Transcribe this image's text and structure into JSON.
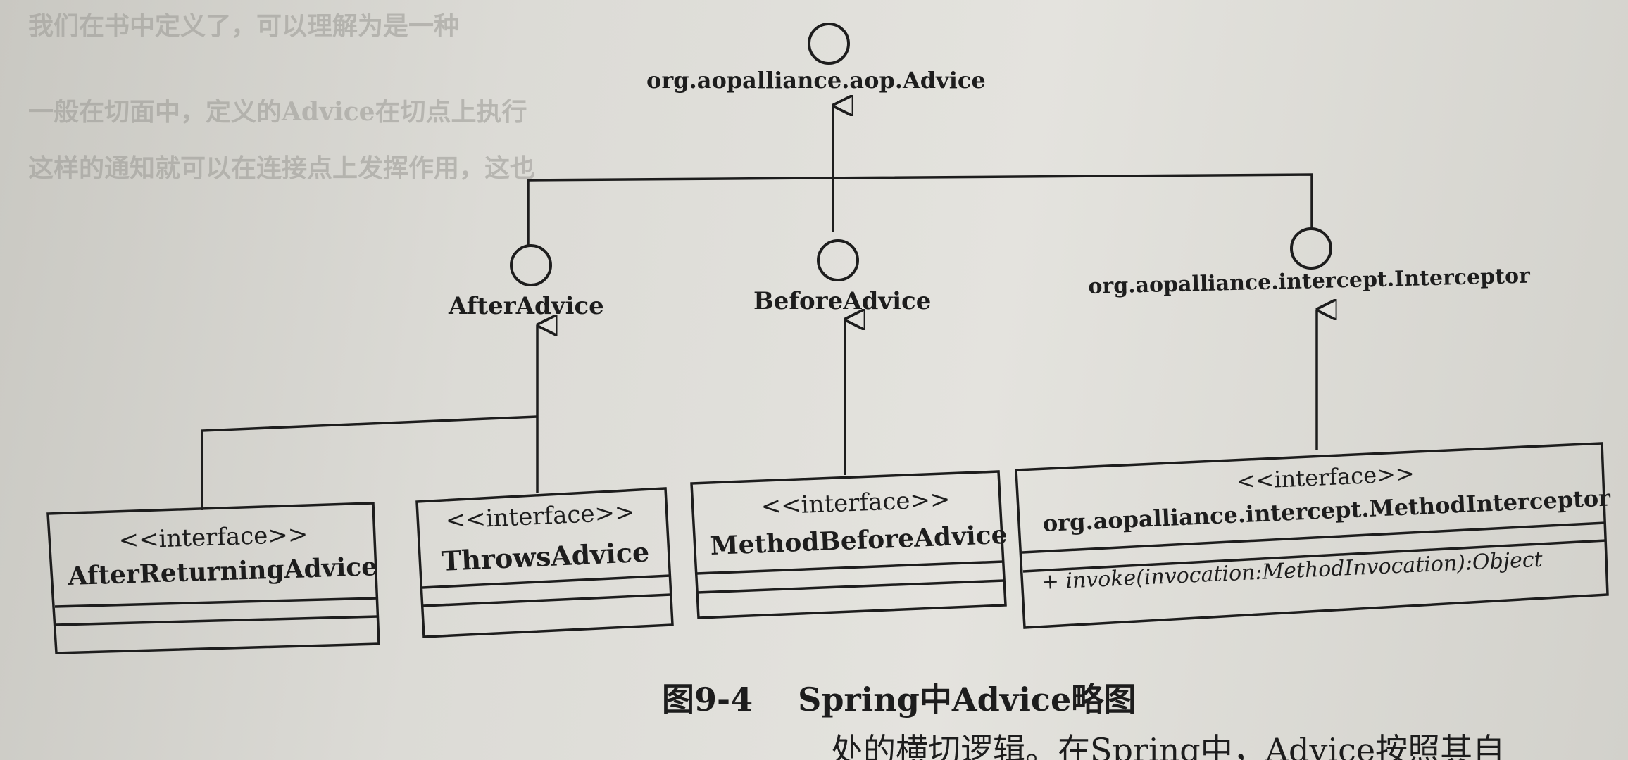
{
  "background_text": [
    "我们在书中定义了，可以理解为是一种",
    "一般在切面中，定义的Advice在切点上执行",
    "这样的通知就可以在连接点上发挥作用，这也"
  ],
  "nodes": {
    "advice": {
      "name": "org.aopalliance.aop.Advice",
      "symbol": "interface-lollipop"
    },
    "after_advice": {
      "name": "AfterAdvice",
      "symbol": "interface-lollipop"
    },
    "before_advice": {
      "name": "BeforeAdvice",
      "symbol": "interface-lollipop"
    },
    "interceptor": {
      "name": "org.aopalliance.intercept.Interceptor",
      "symbol": "interface-lollipop"
    },
    "after_returning": {
      "stereotype": "<<interface>>",
      "name": "AfterReturningAdvice",
      "methods": []
    },
    "throws_advice": {
      "stereotype": "<<interface>>",
      "name": "ThrowsAdvice",
      "methods": []
    },
    "method_before": {
      "stereotype": "<<interface>>",
      "name": "MethodBeforeAdvice",
      "methods": []
    },
    "method_interceptor": {
      "stereotype": "<<interface>>",
      "name": "org.aopalliance.intercept.MethodInterceptor",
      "methods": [
        "+  invoke(invocation:MethodInvocation):Object"
      ]
    }
  },
  "relations": [
    {
      "from": "after_advice",
      "to": "advice",
      "type": "generalization"
    },
    {
      "from": "before_advice",
      "to": "advice",
      "type": "generalization"
    },
    {
      "from": "interceptor",
      "to": "advice",
      "type": "generalization"
    },
    {
      "from": "after_returning",
      "to": "after_advice",
      "type": "generalization"
    },
    {
      "from": "throws_advice",
      "to": "after_advice",
      "type": "generalization"
    },
    {
      "from": "method_before",
      "to": "before_advice",
      "type": "generalization"
    },
    {
      "from": "method_interceptor",
      "to": "interceptor",
      "type": "generalization"
    }
  ],
  "caption": {
    "figure": "图9-4",
    "text": "Spring中Advice略图"
  },
  "bottom_text": "处的横切逻辑。在Spring中，Advice按照其自"
}
